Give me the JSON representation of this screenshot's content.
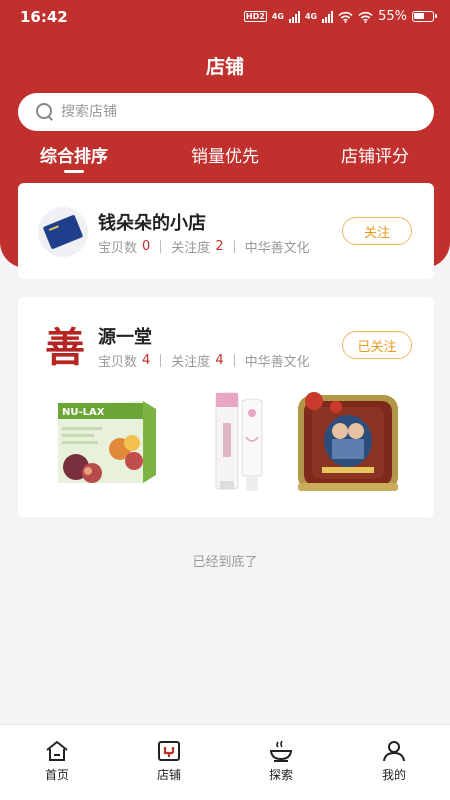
{
  "status": {
    "time": "16:42",
    "hd_badge": "HD",
    "hd_sub": "2",
    "net_1": "4G",
    "net_2": "4G",
    "battery": "55%"
  },
  "header": {
    "title": "店铺"
  },
  "search": {
    "placeholder": "搜索店铺",
    "value": ""
  },
  "tabs": [
    {
      "label": "综合排序",
      "active": true
    },
    {
      "label": "销量优先",
      "active": false
    },
    {
      "label": "店铺评分",
      "active": false
    }
  ],
  "shops": [
    {
      "name": "钱朵朵的小店",
      "items_label": "宝贝数",
      "items_count": "0",
      "follow_label": "关注度",
      "follow_count": "2",
      "category": "中华善文化",
      "button": "关注"
    },
    {
      "name": "源一堂",
      "items_label": "宝贝数",
      "items_count": "4",
      "follow_label": "关注度",
      "follow_count": "4",
      "category": "中华善文化",
      "button": "已关注",
      "logo_char": "善",
      "product_labels": [
        "NU-LAX"
      ]
    }
  ],
  "footer_note": "已经到底了",
  "bottom_nav": [
    {
      "label": "首页",
      "icon": "home-icon"
    },
    {
      "label": "店铺",
      "icon": "shop-icon"
    },
    {
      "label": "探索",
      "icon": "explore-icon"
    },
    {
      "label": "我的",
      "icon": "profile-icon"
    }
  ],
  "colors": {
    "brand_red": "#c0302d",
    "follow_orange": "#e59a20",
    "follow_border": "#f0b860"
  }
}
